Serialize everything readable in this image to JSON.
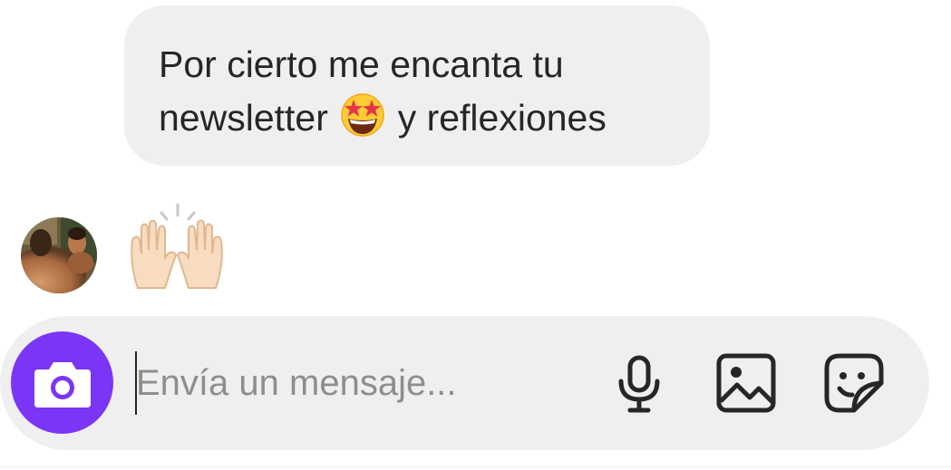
{
  "message": {
    "text_before_emoji": "Por cierto me encanta tu newsletter",
    "emoji": "star-struck-emoji",
    "text_after_emoji": "y reflexiones",
    "bubble_color": "#efefef"
  },
  "reply": {
    "emoji": "raising-hands-emoji"
  },
  "composer": {
    "placeholder": "Envía un mensaje...",
    "value": "",
    "accent_color": "#7b35f5",
    "icons": [
      "camera-icon",
      "microphone-icon",
      "gallery-icon",
      "sticker-icon"
    ]
  }
}
